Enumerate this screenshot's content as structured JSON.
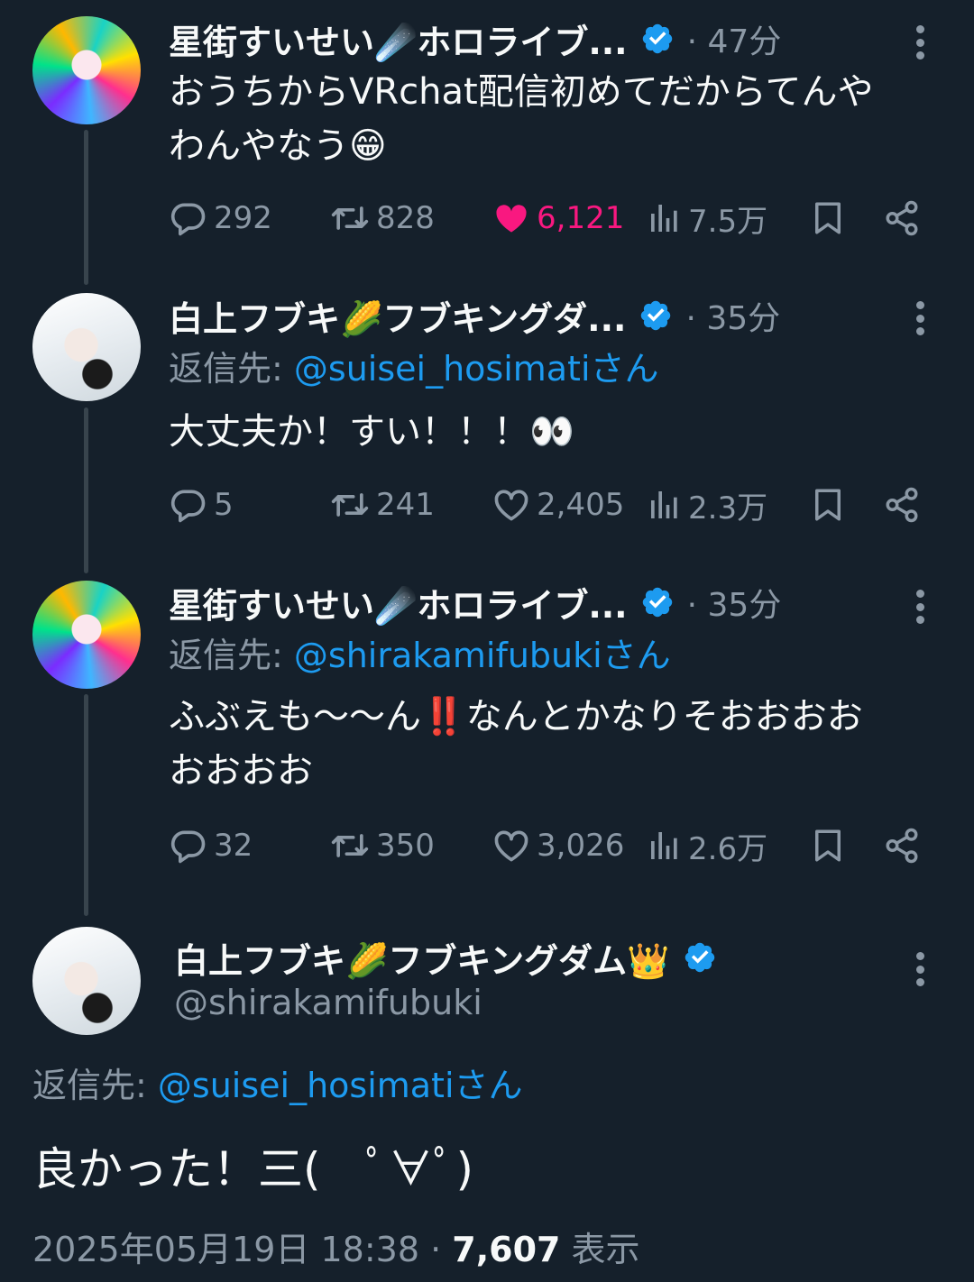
{
  "thread": [
    {
      "display_name": "星街すいせい☄️ホロライブ...",
      "time": "· 47分",
      "text_line1": "おうちからVRchat配信初めてだからてんや",
      "text_line2": "わんやなう😁",
      "stats": {
        "replies": "292",
        "retweets": "828",
        "likes": "6,121",
        "views": "7.5万"
      }
    },
    {
      "display_name": "白上フブキ🌽フブキングダ...",
      "time": "· 35分",
      "reply_prefix": "返信先: ",
      "reply_to": "@suisei_hosimatiさん",
      "text_line1": "大丈夫か！すい！！！👀",
      "stats": {
        "replies": "5",
        "retweets": "241",
        "likes": "2,405",
        "views": "2.3万"
      }
    },
    {
      "display_name": "星街すいせい☄️ホロライブ...",
      "time": "· 35分",
      "reply_prefix": "返信先: ",
      "reply_to": "@shirakamifubukiさん",
      "text_line1": "ふぶえも〜〜ん‼️なんとかなりそおおおお",
      "text_line2": "おおおお",
      "stats": {
        "replies": "32",
        "retweets": "350",
        "likes": "3,026",
        "views": "2.6万"
      }
    }
  ],
  "main_tweet": {
    "display_name": "白上フブキ🌽フブキングダム👑",
    "handle": "@shirakamifubuki",
    "reply_prefix": "返信先: ",
    "reply_to": "@suisei_hosimatiさん",
    "text": "良かった！三(　ﾟ∀ﾟ)",
    "date": "2025年05月19日 18:38 · ",
    "views_count": "7,607",
    "views_label": " 表示"
  },
  "colors": {
    "background": "#15202b",
    "text": "#f7f9f9",
    "muted": "#8b98a5",
    "accent": "#1d9bf0",
    "like": "#f91880",
    "thread_line": "#38444d"
  },
  "icons": [
    "reply-icon",
    "retweet-icon",
    "like-icon",
    "views-icon",
    "bookmark-icon",
    "share-icon",
    "verified-icon",
    "more-icon"
  ]
}
